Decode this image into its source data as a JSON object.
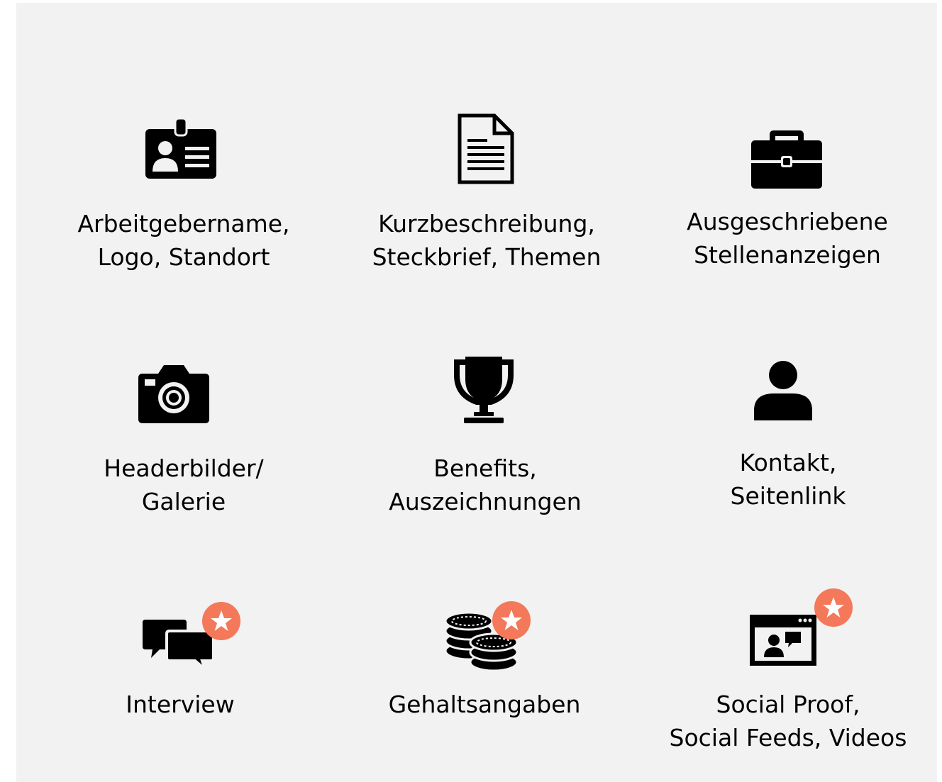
{
  "colors": {
    "background": "#f2f2f2",
    "icon": "#000000",
    "badge": "#f4785a",
    "text": "#000000"
  },
  "features": [
    {
      "icon": "id-badge-icon",
      "label_lines": [
        "Arbeitgebername,",
        "Logo, Standort"
      ],
      "premium": false
    },
    {
      "icon": "document-icon",
      "label_lines": [
        "Kurzbeschreibung,",
        "Steckbrief, Themen"
      ],
      "premium": false
    },
    {
      "icon": "briefcase-icon",
      "label_lines": [
        "Ausgeschriebene",
        "Stellenanzeigen"
      ],
      "premium": false
    },
    {
      "icon": "camera-icon",
      "label_lines": [
        "Headerbilder/",
        "Galerie"
      ],
      "premium": false
    },
    {
      "icon": "trophy-icon",
      "label_lines": [
        "Benefits,",
        "Auszeichnungen"
      ],
      "premium": false
    },
    {
      "icon": "person-icon",
      "label_lines": [
        "Kontakt,",
        "Seitenlink"
      ],
      "premium": false
    },
    {
      "icon": "chat-bubbles-icon",
      "label_lines": [
        "Interview"
      ],
      "premium": true
    },
    {
      "icon": "coins-icon",
      "label_lines": [
        "Gehaltsangaben"
      ],
      "premium": true
    },
    {
      "icon": "video-call-window-icon",
      "label_lines": [
        "Social Proof,",
        "Social Feeds, Videos"
      ],
      "premium": true
    }
  ]
}
